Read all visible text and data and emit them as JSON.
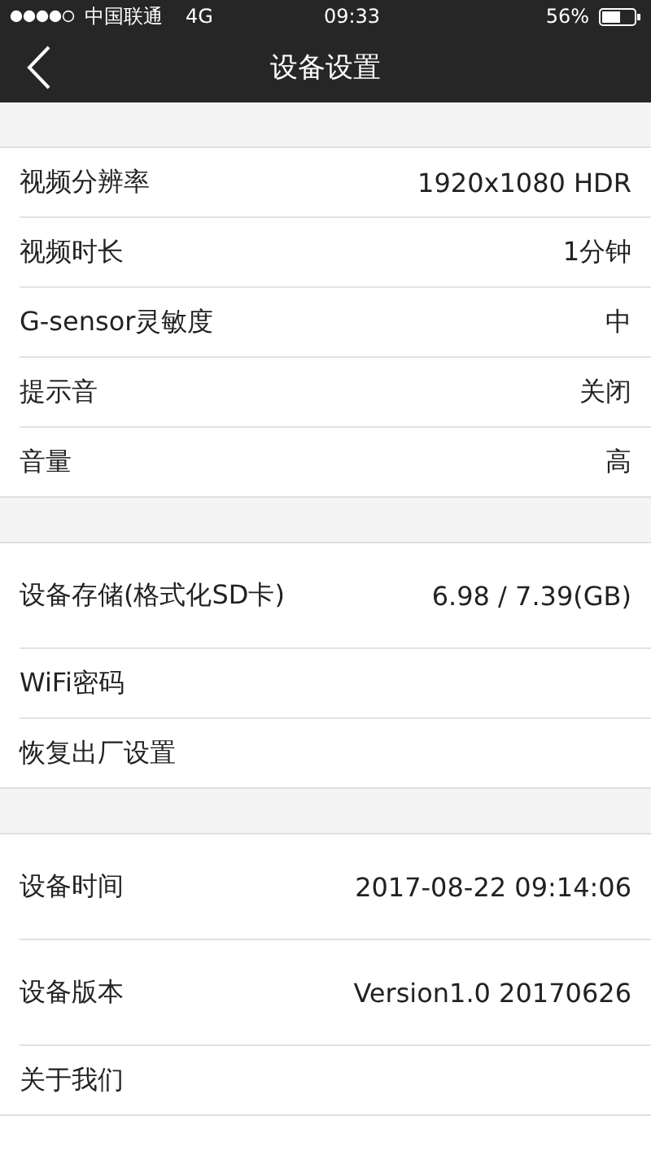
{
  "status_bar": {
    "carrier": "中国联通",
    "network": "4G",
    "time": "09:33",
    "battery": "56%"
  },
  "nav_bar": {
    "title": "设备设置"
  },
  "sections": [
    {
      "rows": [
        {
          "label": "视频分辨率",
          "value": "1920x1080 HDR",
          "kind": "plain"
        },
        {
          "label": "视频时长",
          "value": "1分钟",
          "kind": "plain"
        },
        {
          "label": "G-sensor灵敏度",
          "value": "中",
          "kind": "plain"
        },
        {
          "label": "提示音",
          "value": "关闭",
          "kind": "plain"
        },
        {
          "label": "音量",
          "value": "高",
          "kind": "plain"
        }
      ]
    },
    {
      "rows": [
        {
          "label": "设备存储(格式化SD卡)",
          "value": "6.98 / 7.39(GB)",
          "kind": "tall"
        },
        {
          "label": "WiFi密码",
          "kind": "plain"
        },
        {
          "label": "恢复出厂设置",
          "kind": "plain"
        }
      ]
    },
    {
      "rows": [
        {
          "label": "设备时间",
          "value": "2017-08-22 09:14:06",
          "kind": "tall"
        },
        {
          "label": "设备版本",
          "value": "Version1.0 20170626",
          "kind": "tall"
        },
        {
          "label": "关于我们",
          "kind": "plain"
        }
      ]
    }
  ]
}
